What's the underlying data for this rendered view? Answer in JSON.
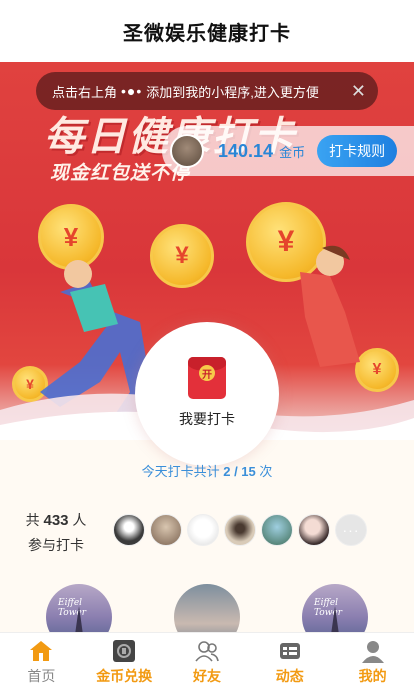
{
  "app": {
    "title": "圣微娱乐健康打卡"
  },
  "banner": {
    "headline": "每日健康打卡",
    "subline": "现金红包送不停"
  },
  "tip": {
    "text_before": "点击右上角",
    "dots": "•●•",
    "text_after": "添加到我的小程序,进入更方便",
    "close": "✕"
  },
  "coins": {
    "amount": "140.14",
    "unit": "金币",
    "rule_button": "打卡规则"
  },
  "checkin": {
    "envelope_char": "开",
    "label": "我要打卡"
  },
  "today": {
    "prefix": "今天打卡共计",
    "count": "2 / 15",
    "suffix": "次"
  },
  "participants": {
    "prefix": "共",
    "count": "433",
    "suffix": "人",
    "line2": "参与打卡"
  },
  "avatars": {
    "colors": [
      "#4a4a4a",
      "#9a8b7a",
      "#f4f4f4",
      "#b59a80",
      "#5f8a6a",
      "#d9c9c3"
    ],
    "more": "···"
  },
  "cards": {
    "script": "Eiffel Tower"
  },
  "tabs": [
    {
      "label": "首页",
      "icon": "home-icon"
    },
    {
      "label": "金币兑换",
      "icon": "coin-exchange-icon"
    },
    {
      "label": "好友",
      "icon": "friends-icon"
    },
    {
      "label": "动态",
      "icon": "feed-icon"
    },
    {
      "label": "我的",
      "icon": "profile-icon"
    }
  ],
  "colors": {
    "accent_orange": "#f29a12",
    "accent_blue": "#2a86d6",
    "banner_red": "#d9363a"
  }
}
